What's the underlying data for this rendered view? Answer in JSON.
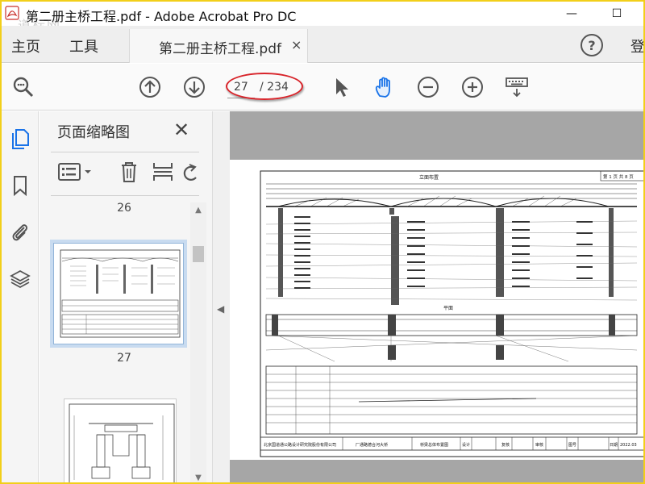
{
  "window": {
    "title": "第二册主桥工程.pdf - Adobe Acrobat Pro DC",
    "watermark": "道标网",
    "minimize_glyph": "—",
    "maximize_glyph": "☐"
  },
  "tabbar": {
    "home_label": "主页",
    "tools_label": "工具",
    "doc_tab_label": "第二册主桥工程.pdf",
    "doc_tab_close": "×",
    "help_label": "?",
    "login_label": "登"
  },
  "toolbar": {
    "page_current": "27",
    "page_total": "/ 234",
    "icons": [
      "search-zoom-icon",
      "page-up-icon",
      "page-down-icon",
      "select-arrow-icon",
      "hand-tool-icon",
      "zoom-out-icon",
      "zoom-in-icon",
      "keyboard-icon"
    ]
  },
  "thumbnails_panel": {
    "title": "页面缩略图",
    "close": "✕",
    "pages": [
      {
        "label": "26"
      },
      {
        "label": "27",
        "selected": true
      },
      {
        "label": ""
      }
    ]
  },
  "drawing_page": {
    "title_block": {
      "company": "北京国道通公路设计研究院股份有限公司",
      "project": "厂通路德合河大桥",
      "sheet": "桥梁总体布置图",
      "design": "设计",
      "review": "复核",
      "audit": "审核",
      "figure_no": "图号",
      "date_label": "日期",
      "date": "2022.03"
    },
    "header_label": "第 1 页  共 8 页",
    "plan_label": "平面",
    "elevation_label": "立面布置"
  },
  "colors": {
    "frame_border": "#f2cf1a",
    "highlight_ellipse": "#d8242a",
    "hand_tool_accent": "#1a73e8",
    "doc_background": "#a6a6a6"
  }
}
